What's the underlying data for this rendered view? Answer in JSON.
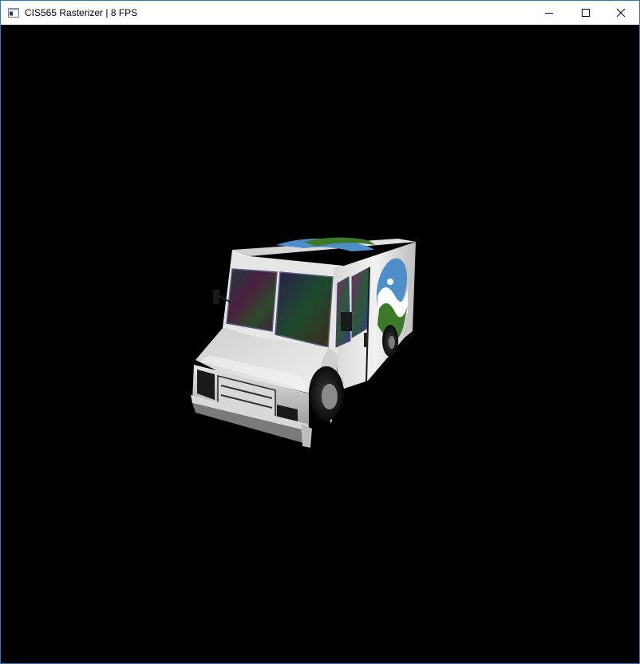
{
  "window": {
    "title": "CIS565 Rasterizer | 8 FPS",
    "controls": [
      "minimize",
      "maximize",
      "close"
    ],
    "accent": "#2b79c2"
  },
  "viewport": {
    "background": "#000000",
    "content": "rasterized-delivery-truck"
  }
}
